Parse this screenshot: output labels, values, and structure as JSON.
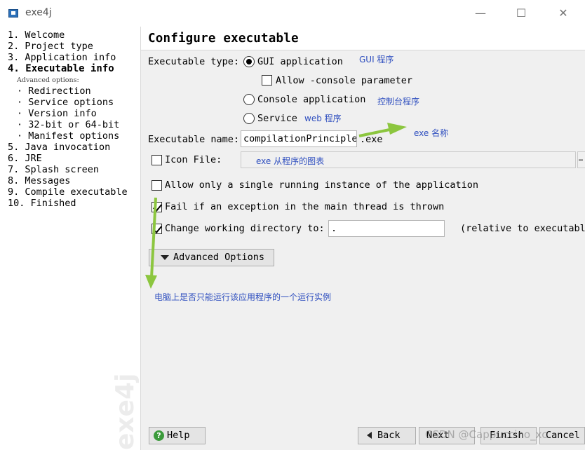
{
  "window": {
    "title": "exe4j",
    "icon": "exe4j-app-icon",
    "controls": {
      "minimize": "—",
      "maximize": "☐",
      "close": "✕"
    }
  },
  "sidebar": {
    "steps": [
      {
        "label": "1. Welcome"
      },
      {
        "label": "2. Project type"
      },
      {
        "label": "3. Application info"
      },
      {
        "label": "4. Executable info",
        "active": true
      },
      {
        "label": "5. Java invocation"
      },
      {
        "label": "6. JRE"
      },
      {
        "label": "7. Splash screen"
      },
      {
        "label": "8. Messages"
      },
      {
        "label": "9. Compile executable"
      },
      {
        "label": "10. Finished"
      }
    ],
    "advanced_label": "Advanced options:",
    "advanced_items": [
      {
        "label": "· Redirection"
      },
      {
        "label": "· Service options"
      },
      {
        "label": "· Version info"
      },
      {
        "label": "· 32-bit or 64-bit"
      },
      {
        "label": "· Manifest options"
      }
    ],
    "watermark": "exe4j"
  },
  "main": {
    "title": "Configure executable",
    "exe_type_label": "Executable type:",
    "radio_gui": "GUI application",
    "allow_console": "Allow -console parameter",
    "radio_console": "Console application",
    "radio_service": "Service",
    "exe_name_label": "Executable name:",
    "exe_name_value": "compilationPrinciple",
    "exe_ext": ".exe",
    "icon_file_label": "Icon File:",
    "single_instance": "Allow only a single running instance of the application",
    "fail_exception": "Fail if an exception in the main thread is thrown",
    "change_dir_label": "Change working directory to:",
    "change_dir_value": ".",
    "relative_note": "(relative to executable",
    "advanced_button": "Advanced Options",
    "state": {
      "gui_selected": true,
      "allow_console_checked": false,
      "icon_checked": false,
      "single_instance_checked": false,
      "fail_exception_checked": true,
      "change_dir_checked": true
    }
  },
  "annotations": {
    "gui": "GUI 程序",
    "console": "控制台程序",
    "service": "web 程序",
    "exe_name": "exe 名称",
    "icon": "exe 从程序的图表",
    "single_instance": "电脑上是否只能运行该应用程序的一个运行实例",
    "color": "#2f4fbf",
    "arrow_color": "#8cc63f"
  },
  "footer": {
    "help": "Help",
    "back": "Back",
    "next": "Next",
    "finish": "Finish",
    "cancel": "Cancel",
    "watermark": "CSDN @Cappuccino_xc"
  }
}
